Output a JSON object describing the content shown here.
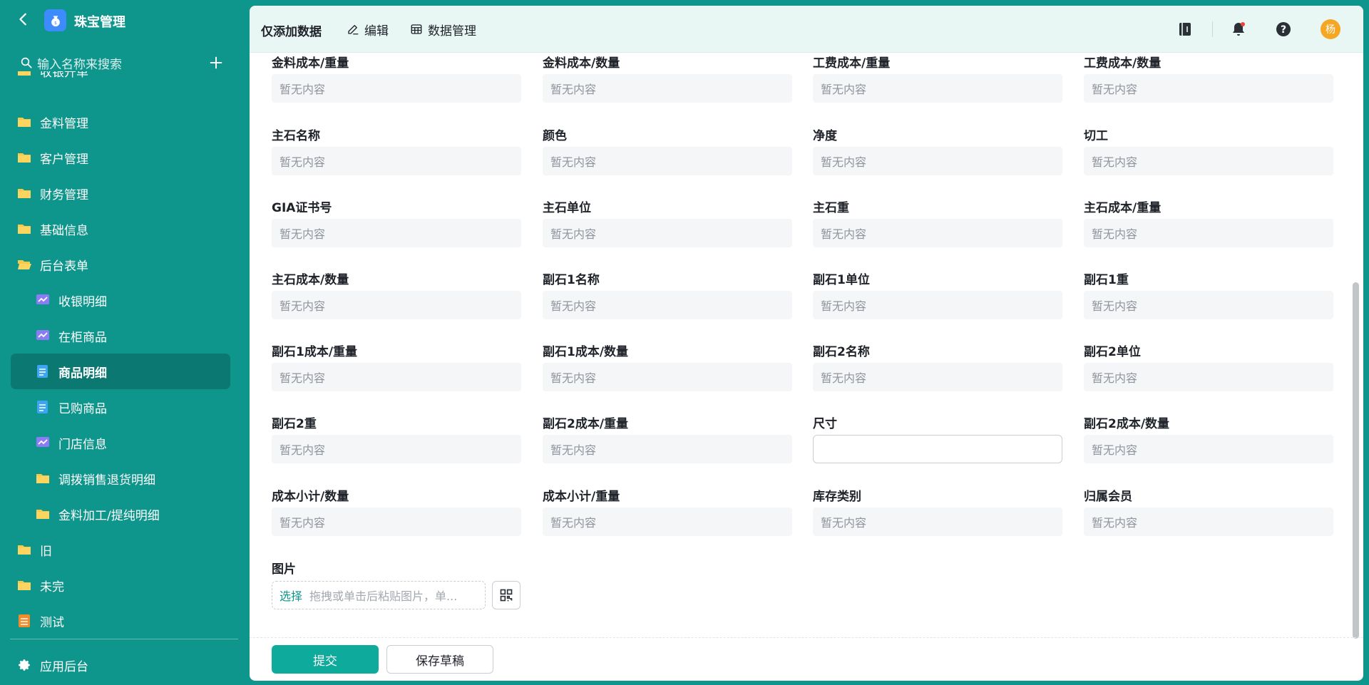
{
  "sidebar": {
    "title": "珠宝管理",
    "search_placeholder": "输入名称来搜索",
    "items": [
      {
        "label": "收银开单",
        "icon": "folder-icon"
      },
      {
        "label": "金料管理",
        "icon": "folder-icon"
      },
      {
        "label": "客户管理",
        "icon": "folder-icon"
      },
      {
        "label": "财务管理",
        "icon": "folder-icon"
      },
      {
        "label": "基础信息",
        "icon": "folder-icon"
      },
      {
        "label": "后台表单",
        "icon": "folder-open-icon"
      },
      {
        "label": "收银明细",
        "icon": "dashboard-icon"
      },
      {
        "label": "在柜商品",
        "icon": "dashboard-icon"
      },
      {
        "label": "商品明细",
        "icon": "form-icon"
      },
      {
        "label": "已购商品",
        "icon": "form-icon"
      },
      {
        "label": "门店信息",
        "icon": "dashboard-icon"
      },
      {
        "label": "调拨销售退货明细",
        "icon": "folder-icon"
      },
      {
        "label": "金料加工/提纯明细",
        "icon": "folder-icon"
      },
      {
        "label": "旧",
        "icon": "folder-icon"
      },
      {
        "label": "未完",
        "icon": "folder-icon"
      },
      {
        "label": "测试",
        "icon": "sheet-icon"
      }
    ],
    "footer_label": "应用后台"
  },
  "topbar": {
    "title": "仅添加数据",
    "edit_label": "编辑",
    "data_manage_label": "数据管理",
    "avatar_text": "杨"
  },
  "form": {
    "empty_text": "暂无内容",
    "fields": [
      "金料成本/重量",
      "金料成本/数量",
      "工费成本/重量",
      "工费成本/数量",
      "主石名称",
      "颜色",
      "净度",
      "切工",
      "GIA证书号",
      "主石单位",
      "主石重",
      "主石成本/重量",
      "主石成本/数量",
      "副石1名称",
      "副石1单位",
      "副石1重",
      "副石1成本/重量",
      "副石1成本/数量",
      "副石2名称",
      "副石2单位",
      "副石2重",
      "副石2成本/重量",
      "尺寸",
      "副石2成本/数量",
      "成本小计/数量",
      "成本小计/重量",
      "库存类别",
      "归属会员"
    ],
    "image_label": "图片",
    "upload_choose": "选择",
    "upload_hint": "拖拽或单击后粘贴图片，单..."
  },
  "actions": {
    "submit_label": "提交",
    "draft_label": "保存草稿"
  },
  "colors": {
    "brand": "#0e958c",
    "primary_button": "#0eaa9c",
    "avatar": "#f5a623"
  }
}
